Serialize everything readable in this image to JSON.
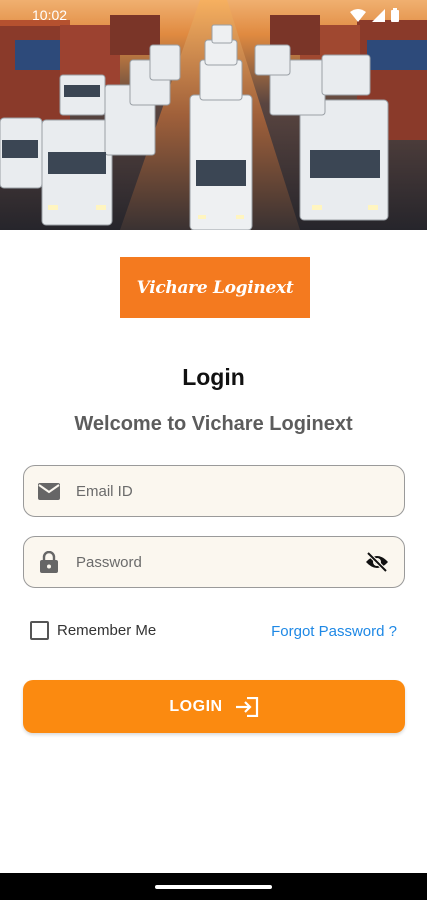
{
  "status_bar": {
    "time": "10:02",
    "icons": [
      "wifi-icon",
      "signal-icon",
      "battery-icon"
    ]
  },
  "hero": {
    "image": "trucks-highway-photo"
  },
  "logo": {
    "text": "Vichare Loginext",
    "background": "#f47a1f"
  },
  "title": "Login",
  "subtitle": "Welcome to Vichare Loginext",
  "email_field": {
    "placeholder": "Email ID",
    "value": "",
    "icon": "mail-icon"
  },
  "password_field": {
    "placeholder": "Password",
    "value": "",
    "icon": "lock-icon",
    "toggle_icon": "eye-off-icon"
  },
  "remember_me": {
    "label": "Remember Me",
    "checked": false
  },
  "forgot_password": {
    "label": "Forgot Password ?"
  },
  "login_button": {
    "label": "LOGIN",
    "icon": "login-arrow-icon",
    "color": "#fb8a10"
  },
  "colors": {
    "accent": "#fb8a10",
    "link": "#1e88e5",
    "field_bg": "#fbf7ef"
  }
}
